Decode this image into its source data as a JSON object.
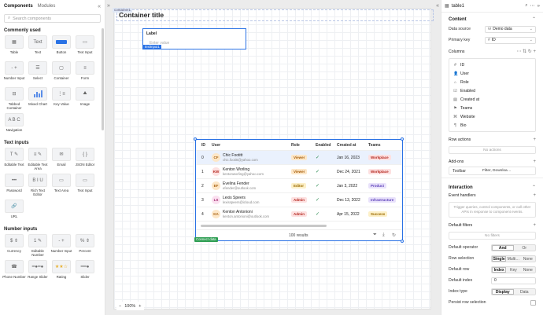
{
  "left_panel": {
    "tabs": [
      "Components",
      "Modules"
    ],
    "search_placeholder": "Search components",
    "sections": [
      {
        "title": "Commonly used",
        "items": [
          "Table",
          "Text",
          "Button",
          "Text Input",
          "Number Input",
          "Select",
          "Container",
          "Form",
          "Tabbed Container",
          "Mixed Chart",
          "Key Value",
          "Image",
          "Navigation"
        ]
      },
      {
        "title": "Text inputs",
        "items": [
          "Editable Text",
          "Editable Text Area",
          "Email",
          "JSON Editor",
          "Password",
          "Rich Text Editor",
          "Text Area",
          "Text Input",
          "URL"
        ]
      },
      {
        "title": "Number inputs",
        "items": [
          "Currency",
          "Editable Number",
          "Number Input",
          "Percent",
          "Phone Number",
          "Range Slider",
          "Rating",
          "Slider"
        ]
      }
    ],
    "button_thumb_text": "Action",
    "text_thumb_text": "Text",
    "new_badge": "New"
  },
  "canvas": {
    "container_tag": "container1",
    "container_title": "Container title",
    "text_input": {
      "label": "Label",
      "placeholder": "Enter value",
      "tag": "textInput1"
    },
    "table": {
      "headers": [
        "ID",
        "User",
        "Role",
        "Enabled",
        "Created at",
        "Teams"
      ],
      "rows": [
        {
          "id": "0",
          "initials": "CF",
          "name": "Chic Footitt",
          "email": "chic.footitt@yahoo.com",
          "role": "Viewer",
          "created": "Jan 16, 2023",
          "team": "Workplace",
          "av_bg": "#fde7c8",
          "av_fg": "#a8610f",
          "role_bg": "#fde7c8",
          "role_fg": "#a8610f",
          "team_bg": "#fde1e1",
          "team_fg": "#b3261e"
        },
        {
          "id": "1",
          "initials": "KW",
          "name": "Kenton Worling",
          "email": "kentonworling@yahoo.com",
          "role": "Viewer",
          "created": "Dec 24, 2021",
          "team": "Workplace",
          "av_bg": "#fde1e1",
          "av_fg": "#b3261e",
          "role_bg": "#fde7c8",
          "role_fg": "#a8610f",
          "team_bg": "#fde1e1",
          "team_fg": "#b3261e"
        },
        {
          "id": "2",
          "initials": "EF",
          "name": "Evelina Fender",
          "email": "efender@outlook.com",
          "role": "Editor",
          "created": "Jan 3, 2022",
          "team": "Product",
          "av_bg": "#fde7c8",
          "av_fg": "#a8610f",
          "role_bg": "#fdf0c8",
          "role_fg": "#9a6a00",
          "team_bg": "#e9e2fb",
          "team_fg": "#5b3fb8"
        },
        {
          "id": "3",
          "initials": "LS",
          "name": "Lexis Speers",
          "email": "lexisspeers@icloud.com",
          "role": "Admin",
          "created": "Dec 13, 2022",
          "team": "Infrastructure",
          "av_bg": "#fbe0f0",
          "av_fg": "#a2296f",
          "role_bg": "#fde1e1",
          "role_fg": "#b3261e",
          "team_bg": "#e9e2fb",
          "team_fg": "#5b3fb8"
        },
        {
          "id": "4",
          "initials": "KA",
          "name": "Kenton Antonioni",
          "email": "kenton.antonioni@outlook.com",
          "role": "Admin",
          "created": "Apr 15, 2022",
          "team": "Success",
          "av_bg": "#fde7c8",
          "av_fg": "#a8610f",
          "role_bg": "#fde1e1",
          "role_fg": "#b3261e",
          "team_bg": "#fdf0c8",
          "team_fg": "#9a6a00"
        }
      ],
      "results": "100 results",
      "connect_tag": "Connect data"
    },
    "zoom": "100%"
  },
  "right_panel": {
    "component_name": "table1",
    "content_title": "Content",
    "data_source_label": "Data source",
    "data_source_value": "Demo data",
    "primary_key_label": "Primary key",
    "primary_key_value": "ID",
    "columns_title": "Columns",
    "columns": [
      "ID",
      "User",
      "Role",
      "Enabled",
      "Created at",
      "Teams",
      "Website",
      "Bio"
    ],
    "row_actions_title": "Row actions",
    "no_actions": "No actions",
    "addons_title": "Add-ons",
    "toolbar_label": "Toolbar",
    "toolbar_value": "Filter, Downloa…",
    "interaction_title": "Interaction",
    "event_handlers_title": "Event handlers",
    "event_handlers_desc": "Trigger queries, control components, or call other APIs in response to component events.",
    "default_filters_title": "Default filters",
    "no_filters": "No filters",
    "default_operator_label": "Default operator",
    "operator_options": [
      "And",
      "Or"
    ],
    "row_selection_label": "Row selection",
    "row_selection_options": [
      "Single",
      "Multi…",
      "None"
    ],
    "default_row_label": "Default row",
    "default_row_options": [
      "Index",
      "Key",
      "None"
    ],
    "default_index_label": "Default index",
    "default_index_value": "0",
    "index_type_label": "Index type",
    "index_type_options": [
      "Display",
      "Data"
    ],
    "persist_label": "Persist row selection"
  }
}
